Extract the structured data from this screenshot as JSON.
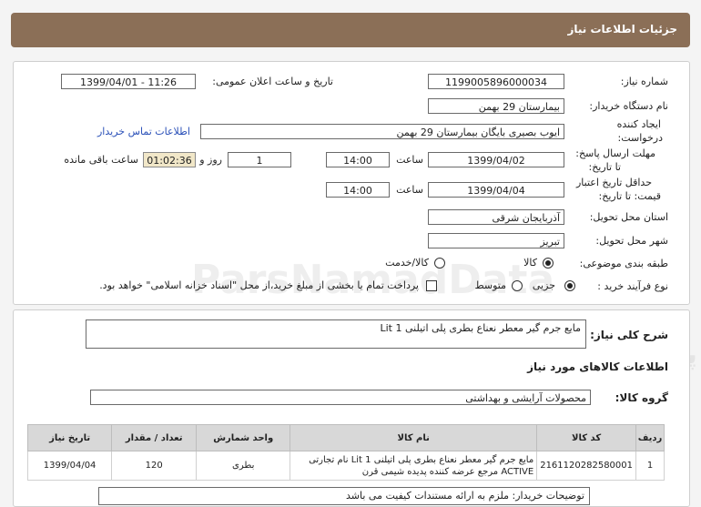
{
  "header": {
    "title": "جزئیات اطلاعات نیاز"
  },
  "form": {
    "need_number": {
      "label": "شماره نیاز:",
      "value": "1199005896000034"
    },
    "announce_datetime": {
      "label": "تاریخ و ساعت اعلان عمومی:",
      "value": "1399/04/01 - 11:26"
    },
    "buyer_org": {
      "label": "نام دستگاه خریدار:",
      "value": "بیمارستان 29 بهمن"
    },
    "requester": {
      "label_line1": "ایجاد کننده",
      "label_line2": "درخواست:",
      "value": "ایوب بصیری  بایگان بیمارستان 29 بهمن"
    },
    "contact_link": "اطلاعات تماس خریدار",
    "reply_deadline": {
      "label_line1": "مهلت ارسال پاسخ:",
      "label_line2": "تا تاریخ:",
      "date": "1399/04/02",
      "time_label": "ساعت",
      "time": "14:00",
      "days": "1",
      "days_label": "روز و",
      "remaining": "01:02:36",
      "remaining_label": "ساعت باقی مانده"
    },
    "price_validity": {
      "label_line1": "حداقل تاریخ اعتبار",
      "label_line2": "قیمت: تا تاریخ:",
      "date": "1399/04/04",
      "time_label": "ساعت",
      "time": "14:00"
    },
    "province": {
      "label": "استان محل تحویل:",
      "value": "آذربایجان شرقی"
    },
    "city": {
      "label": "شهر محل تحویل:",
      "value": "تبریز"
    },
    "category": {
      "label": "طبقه بندی موضوعی:",
      "options": [
        "کالا",
        "کالا/خدمت"
      ],
      "selected": "کالا"
    },
    "purchase_type": {
      "label": "نوع فرآیند خرید :",
      "options": [
        "جزیی",
        "متوسط"
      ],
      "selected": "جزیی",
      "payment_note": "پرداخت تمام یا بخشی از مبلغ خرید،از محل \"اسناد خزانه اسلامی\" خواهد بود."
    }
  },
  "details": {
    "summary_label": "شرح کلی نیاز:",
    "summary_value": "مایع جرم گیر معطر نعناع بطری پلی اتیلنی 1 Lit",
    "goods_info_title": "اطلاعات کالاهای مورد نیاز",
    "goods_group_label": "گروه کالا:",
    "goods_group_value": "محصولات آرایشی و بهداشتی",
    "table": {
      "headers": [
        "ردیف",
        "کد کالا",
        "نام کالا",
        "واحد شمارش",
        "تعداد / مقدار",
        "تاریخ نیاز"
      ],
      "rows": [
        {
          "row": "1",
          "code": "2161120282580001",
          "name": "مایع جرم گیر معطر نعناع بطری پلی اتیلنی 1 Lit نام تجارتی ACTIVE مرجع عرضه کننده پدیده شیمی قرن",
          "unit": "بطری",
          "qty": "120",
          "date": "1399/04/04"
        }
      ]
    },
    "buyer_notes_partial": "توضیحات خریدار: ملزم به ارائه مستندات کیفیت می باشد"
  },
  "watermark": {
    "brand": "ParsNamadData",
    "phone": "۰۲۱-۸۸۳۴۹۶۷۰-۵",
    "tagline": "پایگاه اطلاع رسانی مناقصه و مزایده"
  }
}
